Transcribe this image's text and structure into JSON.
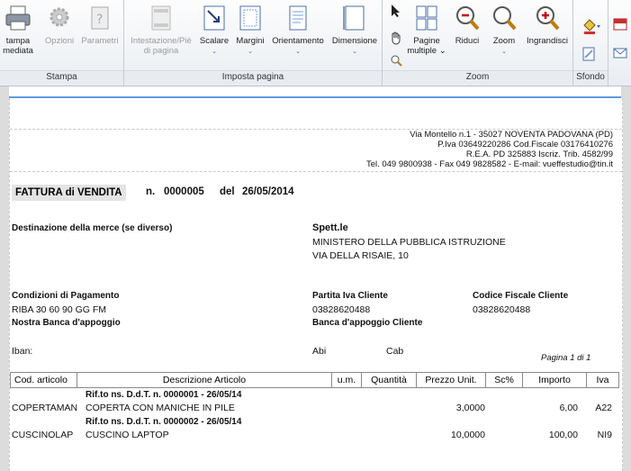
{
  "ribbon": {
    "stampa_group": {
      "label": "Stampa",
      "buttons": [
        {
          "label1": "tampa",
          "label2": "mediata",
          "icon": "printer-icon",
          "enabled": true
        },
        {
          "label1": "Opzioni",
          "label2": "",
          "icon": "gear-icon",
          "enabled": false
        },
        {
          "label1": "Parametri",
          "label2": "",
          "icon": "help-clipboard-icon",
          "enabled": false
        }
      ]
    },
    "imposta_group": {
      "label": "Imposta pagina",
      "buttons": [
        {
          "label1": "Intestazione/Piè",
          "label2": "di pagina",
          "icon": "header-footer-icon",
          "enabled": false
        },
        {
          "label1": "Scalare",
          "label2": "⌄",
          "icon": "scale-icon",
          "enabled": true
        },
        {
          "label1": "Margini",
          "label2": "⌄",
          "icon": "margins-icon",
          "enabled": true
        },
        {
          "label1": "Orientamento",
          "label2": "⌄",
          "icon": "orientation-icon",
          "enabled": true
        },
        {
          "label1": "Dimensione",
          "label2": "⌄",
          "icon": "page-size-icon",
          "enabled": true
        }
      ]
    },
    "zoom_group": {
      "label": "Zoom",
      "buttons": [
        {
          "label1": "Pagine",
          "label2": "multiple ⌄",
          "icon": "multiple-pages-icon"
        },
        {
          "label1": "Riduci",
          "label2": "",
          "icon": "zoom-out-icon"
        },
        {
          "label1": "Zoom",
          "label2": "⌄",
          "icon": "zoom-icon"
        },
        {
          "label1": "Ingrandisci",
          "label2": "",
          "icon": "zoom-in-icon"
        }
      ]
    },
    "sfondo_group": {
      "label": "Sfondo"
    }
  },
  "document": {
    "company": {
      "line1": "Via Montello n.1 - 35027 NOVENTA PADOVANA (PD)",
      "line2": "P.Iva 03649220286 Cod.Fiscale 03176410276",
      "line3": "R.E.A. PD 325883  Iscriz. Trib. 4582/99",
      "line4": "Tel. 049 9800938 - Fax 049 9828582 - E-mail: vueffestudio@tin.it"
    },
    "title": "FATTURA  di VENDITA",
    "number_label": "n.",
    "number": "0000005",
    "date_label": "del",
    "date": "26/05/2014",
    "destination_label": "Destinazione della merce (se diverso)",
    "recipient_label": "Spett.le",
    "recipient_name": "MINISTERO DELLA PUBBLICA ISTRUZIONE",
    "recipient_address": "VIA DELLA RISAIE, 10",
    "payment_label": "Condizioni di Pagamento",
    "payment_value": "RIBA 30 60 90 GG FM",
    "bank_label": "Nostra Banca d'appoggio",
    "piva_label": "Partita Iva Cliente",
    "piva_value": "03828620488",
    "client_bank_label": "Banca d'appoggio Cliente",
    "cf_label": "Codice Fiscale Cliente",
    "cf_value": "03828620488",
    "iban_label": "Iban:",
    "abi_label": "Abi",
    "cab_label": "Cab",
    "page_label": "Pagina 1 di 1",
    "table": {
      "headers": [
        "Cod. articolo",
        "Descrizione Articolo",
        "u.m.",
        "Quantità",
        "Prezzo Unit.",
        "Sc%",
        "Importo",
        "Iva"
      ],
      "rows": [
        {
          "ref": "Rif.to ns. D.d.T. n.    0000001  -  26/05/14",
          "code": "COPERTAMAN",
          "desc": "COPERTA CON MANICHE IN PILE",
          "price": "3,0000",
          "amount": "6,00",
          "iva": "A22"
        },
        {
          "ref": "Rif.to ns. D.d.T. n.    0000002  -  26/05/14",
          "code": "CUSCINOLAP",
          "desc": "CUSCINO LAPTOP",
          "price": "10,0000",
          "amount": "100,00",
          "iva": "NI9"
        }
      ]
    }
  }
}
